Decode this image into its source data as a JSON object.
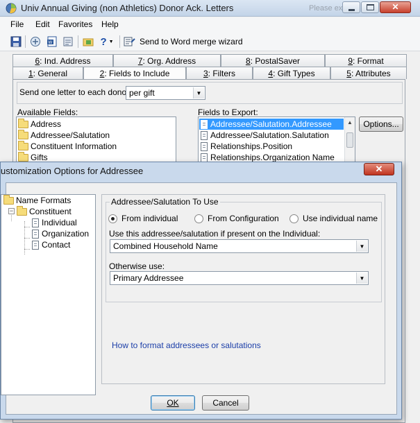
{
  "main_window": {
    "title": "Univ Annual Giving (non Athletics) Donor Ack. Letters",
    "ghost_text": "Please ex",
    "menu": [
      "File",
      "Edit",
      "Favorites",
      "Help"
    ],
    "toolbar": {
      "merge_label": "Send to Word merge wizard",
      "icons": [
        "save-icon",
        "print-preview-icon",
        "word-doc-icon",
        "favorites-icon",
        "export-icon",
        "help-icon",
        "merge-wizard-icon"
      ]
    },
    "tabs_back": [
      {
        "num": "6",
        "label": ": Ind. Address"
      },
      {
        "num": "7",
        "label": ": Org. Address"
      },
      {
        "num": "8",
        "label": ": PostalSaver"
      },
      {
        "num": "9",
        "label": ": Format"
      }
    ],
    "tabs_front": [
      {
        "num": "1",
        "label": ": General"
      },
      {
        "num": "2",
        "label": ": Fields to Include"
      },
      {
        "num": "3",
        "label": ": Filters"
      },
      {
        "num": "4",
        "label": ": Gift Types"
      },
      {
        "num": "5",
        "label": ": Attributes"
      }
    ],
    "send_label": "Send one letter to each donor:",
    "send_value": "per gift",
    "available_label": "Available Fields:",
    "available_fields": [
      "Address",
      "Addressee/Salutation",
      "Constituent Information",
      "Gifts"
    ],
    "export_label": "Fields to Export:",
    "export_fields": [
      "Addressee/Salutation.Addressee",
      "Addressee/Salutation.Salutation",
      "Relationships.Position",
      "Relationships.Organization Name"
    ],
    "options_button": "Options..."
  },
  "dialog": {
    "title": "ustomization Options for Addressee",
    "close_symbol": "✕",
    "tree": {
      "root": "Name Formats",
      "child": "Constituent",
      "leaves": [
        "Individual",
        "Organization",
        "Contact"
      ]
    },
    "group_title": "Addressee/Salutation To Use",
    "radios": [
      {
        "label": "From individual",
        "checked": true
      },
      {
        "label": "From Configuration",
        "checked": false
      },
      {
        "label": "Use individual name",
        "checked": false
      }
    ],
    "use_label": "Use this addressee/salutation if present on the Individual:",
    "use_value": "Combined Household Name",
    "otherwise_label": "Otherwise use:",
    "otherwise_value": "Primary Addressee",
    "help_link": "How to format addressees or salutations",
    "ok_button": "OK",
    "cancel_button": "Cancel"
  },
  "colors": {
    "selection": "#3399ff",
    "link": "#1b3ea8",
    "dialog_frame": "#c9d9ec"
  }
}
